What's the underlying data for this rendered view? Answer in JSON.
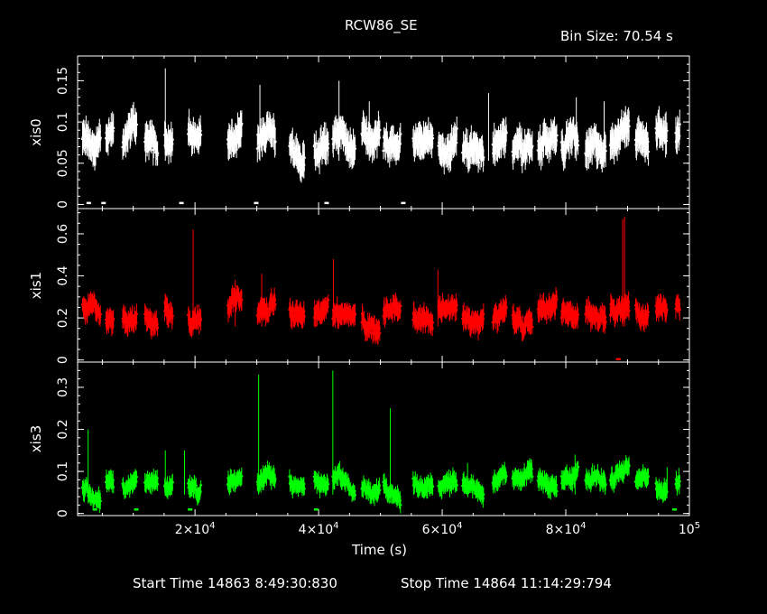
{
  "header": {
    "title": "RCW86_SE",
    "bin_size": "Bin Size: 70.54 s"
  },
  "footer": {
    "start": "Start Time 14863  8:49:30:830",
    "stop": "Stop Time 14864 11:14:29:794"
  },
  "chart_data": {
    "type": "scatter",
    "xlabel": "Time (s)",
    "xlim": [
      1000,
      100000
    ],
    "x_ticks": [
      {
        "value": 20000,
        "mant": "2×10",
        "exp": "4"
      },
      {
        "value": 40000,
        "mant": "4×10",
        "exp": "4"
      },
      {
        "value": 60000,
        "mant": "6×10",
        "exp": "4"
      },
      {
        "value": 80000,
        "mant": "8×10",
        "exp": "4"
      },
      {
        "value": 100000,
        "mant": "10",
        "exp": "5"
      }
    ],
    "x_minor_step": 5000,
    "panels": [
      {
        "name": "xis0",
        "ylabel": "xis0",
        "color": "#ffffff",
        "ylim": [
          -0.005,
          0.18
        ],
        "yticks": [
          {
            "v": 0,
            "label": "0"
          },
          {
            "v": 0.05,
            "label": "0.05"
          },
          {
            "v": 0.1,
            "label": "0.1"
          },
          {
            "v": 0.15,
            "label": "0.15"
          }
        ],
        "y_minor_step": 0.01,
        "mean": 0.075,
        "spread": 0.022,
        "spikes": [
          [
            15200,
            0.165
          ],
          [
            30500,
            0.145
          ],
          [
            43300,
            0.15
          ],
          [
            48200,
            0.125
          ],
          [
            67500,
            0.135
          ],
          [
            81700,
            0.13
          ],
          [
            86200,
            0.125
          ]
        ],
        "lows": [
          [
            2800,
            0.002
          ],
          [
            5200,
            0.002
          ],
          [
            17800,
            0.002
          ],
          [
            29900,
            0.002
          ],
          [
            41300,
            0.002
          ],
          [
            53700,
            0.002
          ]
        ]
      },
      {
        "name": "xis1",
        "ylabel": "xis1",
        "color": "#ff0000",
        "ylim": [
          -0.01,
          0.72
        ],
        "yticks": [
          {
            "v": 0,
            "label": "0"
          },
          {
            "v": 0.2,
            "label": "0.2"
          },
          {
            "v": 0.4,
            "label": "0.4"
          },
          {
            "v": 0.6,
            "label": "0.6"
          }
        ],
        "y_minor_step": 0.05,
        "mean": 0.22,
        "spread": 0.06,
        "spikes": [
          [
            19700,
            0.62
          ],
          [
            26500,
            0.38
          ],
          [
            30800,
            0.41
          ],
          [
            42400,
            0.48
          ],
          [
            59300,
            0.43
          ],
          [
            89200,
            0.67
          ],
          [
            89500,
            0.68
          ]
        ],
        "lows": [
          [
            88500,
            0.005
          ]
        ]
      },
      {
        "name": "xis3",
        "ylabel": "xis3",
        "color": "#00ff00",
        "ylim": [
          -0.005,
          0.36
        ],
        "yticks": [
          {
            "v": 0,
            "label": "0"
          },
          {
            "v": 0.1,
            "label": "0.1"
          },
          {
            "v": 0.2,
            "label": "0.2"
          },
          {
            "v": 0.3,
            "label": "0.3"
          }
        ],
        "y_minor_step": 0.02,
        "mean": 0.07,
        "spread": 0.025,
        "spikes": [
          [
            2700,
            0.2
          ],
          [
            15200,
            0.15
          ],
          [
            18300,
            0.15
          ],
          [
            30300,
            0.33
          ],
          [
            42300,
            0.34
          ],
          [
            51600,
            0.25
          ],
          [
            64100,
            0.12
          ],
          [
            81500,
            0.14
          ],
          [
            96400,
            0.11
          ]
        ],
        "lows": [
          [
            3800,
            0.01
          ],
          [
            10500,
            0.01
          ],
          [
            19200,
            0.01
          ],
          [
            39600,
            0.01
          ],
          [
            97600,
            0.01
          ]
        ]
      }
    ],
    "segments": [
      [
        1800,
        4700
      ],
      [
        5600,
        6800
      ],
      [
        8300,
        10600
      ],
      [
        11900,
        14000
      ],
      [
        15100,
        16400
      ],
      [
        18900,
        21000
      ],
      [
        25300,
        27600
      ],
      [
        30100,
        33000
      ],
      [
        35300,
        37700
      ],
      [
        39300,
        41600
      ],
      [
        42300,
        45900
      ],
      [
        47000,
        49900
      ],
      [
        50500,
        53300
      ],
      [
        55300,
        58500
      ],
      [
        59400,
        62400
      ],
      [
        63300,
        66700
      ],
      [
        68200,
        70400
      ],
      [
        71400,
        74600
      ],
      [
        75500,
        78600
      ],
      [
        79300,
        82000
      ],
      [
        83200,
        86500
      ],
      [
        87200,
        90300
      ],
      [
        91300,
        93400
      ],
      [
        94600,
        96400
      ],
      [
        97800,
        98500
      ]
    ]
  }
}
